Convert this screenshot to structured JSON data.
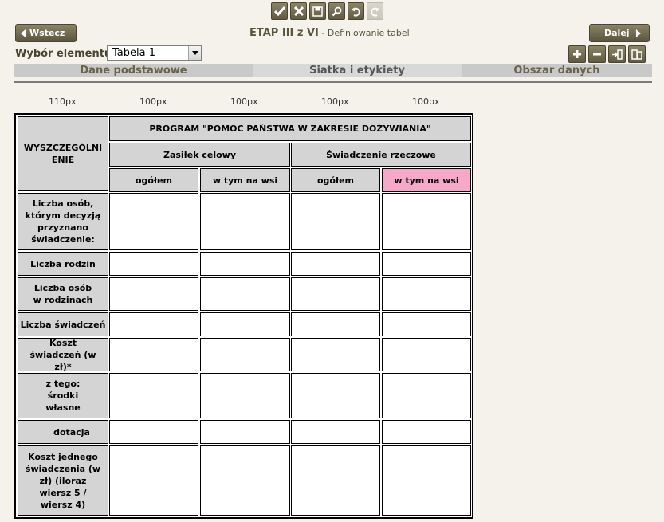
{
  "toolbar": {
    "icons": [
      "check-icon",
      "x-icon",
      "save-icon",
      "search-icon",
      "undo-icon",
      "redo-icon"
    ]
  },
  "nav": {
    "back_label": "Wstecz",
    "next_label": "Dalej"
  },
  "header": {
    "title_main": "ETAP III z VI",
    "title_sub": " - Definiowanie tabel"
  },
  "element_select": {
    "label": "Wybór elementu:",
    "value": "Tabela 1"
  },
  "tabs": [
    {
      "label": "Dane podstawowe"
    },
    {
      "label": "Siatka i etykiety"
    },
    {
      "label": "Obszar danych"
    }
  ],
  "column_widths": [
    "110px",
    "100px",
    "100px",
    "100px",
    "100px"
  ],
  "table": {
    "corner": "WYSZCZEGÓLNIENIE",
    "program": "PROGRAM \"POMOC PAŃSTWA W ZAKRESIE DOŻYWIANIA\"",
    "group1": "Zasiłek celowy",
    "group2": "Świadczenie rzeczowe",
    "sub_headers": [
      "ogółem",
      "w tym na wsi",
      "ogółem",
      "w tym na wsi"
    ],
    "highlight_color": "#f7a8c8",
    "rows": [
      "Liczba osób, którym decyzją przyznano świadczenie:",
      "Liczba rodzin",
      "Liczba osób w rodzinach",
      "Liczba świadczeń",
      "Koszt świadczeń (w zł)*",
      "z tego: środki własne",
      "dotacja",
      "Koszt jednego świadczenia (w zł) (iloraz wiersz 5 / wiersz 4)"
    ]
  }
}
